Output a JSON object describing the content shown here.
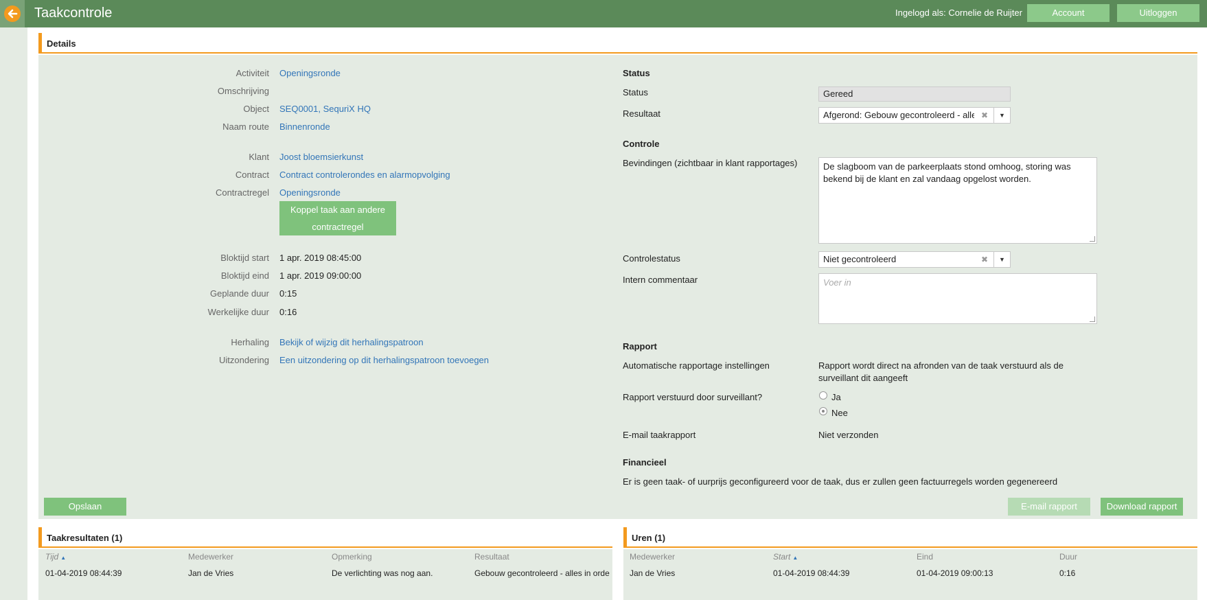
{
  "header": {
    "title": "Taakcontrole",
    "login_info": "Ingelogd als: Cornelie de Ruijter",
    "account_label": "Account",
    "logout_label": "Uitloggen"
  },
  "details": {
    "title": "Details",
    "left": {
      "activity_label": "Activiteit",
      "activity_value": "Openingsronde",
      "description_label": "Omschrijving",
      "object_label": "Object",
      "object_value": "SEQ0001, SequriX HQ",
      "route_label": "Naam route",
      "route_value": "Binnenronde",
      "client_label": "Klant",
      "client_value": "Joost bloemsierkunst",
      "contract_label": "Contract",
      "contract_value": "Contract controlerondes en alarmopvolging",
      "contract_rule_label": "Contractregel",
      "contract_rule_value": "Openingsronde",
      "couple_button_line1": "Koppel taak aan andere",
      "couple_button_line2": "contractregel",
      "block_start_label": "Bloktijd start",
      "block_start_value": "1 apr. 2019 08:45:00",
      "block_end_label": "Bloktijd eind",
      "block_end_value": "1 apr. 2019 09:00:00",
      "planned_label": "Geplande duur",
      "planned_value": "0:15",
      "actual_label": "Werkelijke duur",
      "actual_value": "0:16",
      "repeat_label": "Herhaling",
      "repeat_value": "Bekijk of wijzig dit herhalingspatroon",
      "exception_label": "Uitzondering",
      "exception_value": "Een uitzondering op dit herhalingspatroon toevoegen"
    },
    "right": {
      "status_section": "Status",
      "status_label": "Status",
      "status_value": "Gereed",
      "result_label": "Resultaat",
      "result_value": "Afgerond: Gebouw gecontroleerd - alles in orde",
      "control_section": "Controle",
      "findings_label": "Bevindingen (zichtbaar in klant rapportages)",
      "findings_value": "De slagboom van de parkeerplaats stond omhoog, storing was bekend bij de klant en zal vandaag opgelost worden.",
      "control_status_label": "Controlestatus",
      "control_status_value": "Niet gecontroleerd",
      "intern_label": "Intern commentaar",
      "intern_placeholder": "Voer in",
      "report_section": "Rapport",
      "auto_report_label": "Automatische rapportage instellingen",
      "auto_report_line1": "Rapport wordt direct na afronden van de taak verstuurd als de",
      "auto_report_line2": "surveillant dit aangeeft",
      "sent_by_label": "Rapport verstuurd door surveillant?",
      "option_yes": "Ja",
      "option_no": "Nee",
      "email_report_label": "E-mail taakrapport",
      "email_report_value": "Niet verzonden",
      "financial_section": "Financieel",
      "financial_text": "Er is geen taak- of uurprijs geconfigureerd voor de taak, dus er zullen geen factuurregels worden gegenereerd"
    },
    "save_label": "Opslaan",
    "email_button_label": "E-mail rapport",
    "download_button_label": "Download rapport"
  },
  "task_results": {
    "title": "Taakresultaten (1)",
    "columns": [
      "Tijd",
      "Medewerker",
      "Opmerking",
      "Resultaat"
    ],
    "rows": [
      [
        "01-04-2019 08:44:39",
        "Jan de Vries",
        "De verlichting was nog aan.",
        "Gebouw gecontroleerd - alles in orde"
      ]
    ]
  },
  "hours": {
    "title": "Uren (1)",
    "columns": [
      "Medewerker",
      "Start",
      "Eind",
      "Duur"
    ],
    "rows": [
      [
        "Jan de Vries",
        "01-04-2019 08:44:39",
        "01-04-2019 09:00:13",
        "0:16"
      ]
    ]
  },
  "colors": {
    "topbar": "#5b8a59",
    "accent": "#f39a1e",
    "button_green": "#7fc27c",
    "link": "#3275b8",
    "panel_bg": "#e4ebe3"
  }
}
